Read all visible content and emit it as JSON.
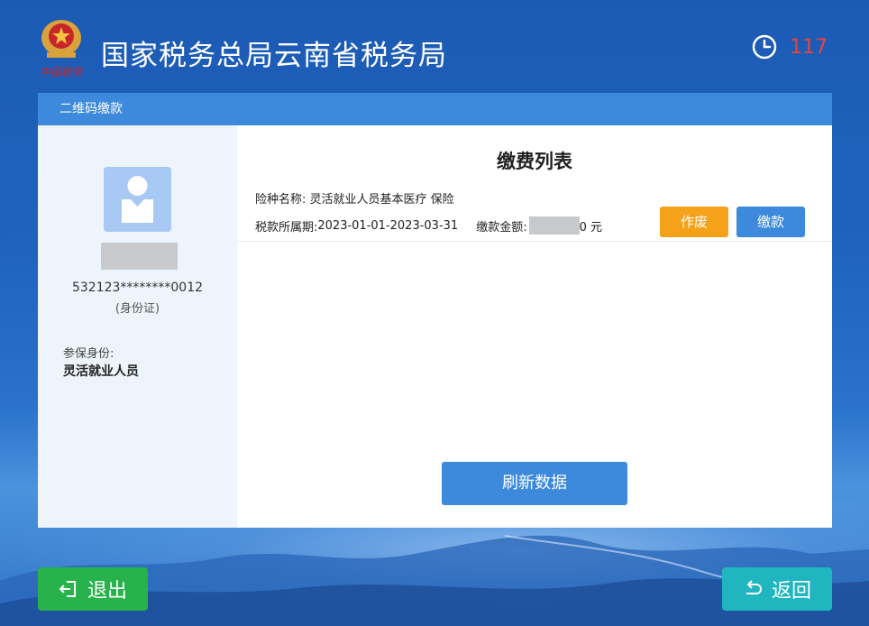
{
  "header": {
    "title": "国家税务总局云南省税务局",
    "timer": "117",
    "emblem_text": "中国税务"
  },
  "panel": {
    "title": "二维码缴款"
  },
  "person": {
    "id_number": "532123********0012",
    "id_type": "(身份证)",
    "insured_label": "参保身份:",
    "insured_value": "灵活就业人员"
  },
  "payment_list": {
    "title": "缴费列表",
    "insurance_label": "险种名称:",
    "insurance_value": "灵活就业人员基本医疗 保险",
    "period_label": "税款所属期:",
    "period_value": "2023-01-01-2023-03-31",
    "amount_label": "缴款金额:",
    "amount_suffix": "0 元",
    "void_button": "作废",
    "pay_button": "缴款",
    "refresh_button": "刷新数据"
  },
  "footer": {
    "exit_button": "退出",
    "back_button": "返回"
  },
  "colors": {
    "accent": "#3d89db",
    "void": "#f5a11a",
    "exit": "#28b24b",
    "back": "#1fb6c0",
    "timer": "#e8443a"
  }
}
